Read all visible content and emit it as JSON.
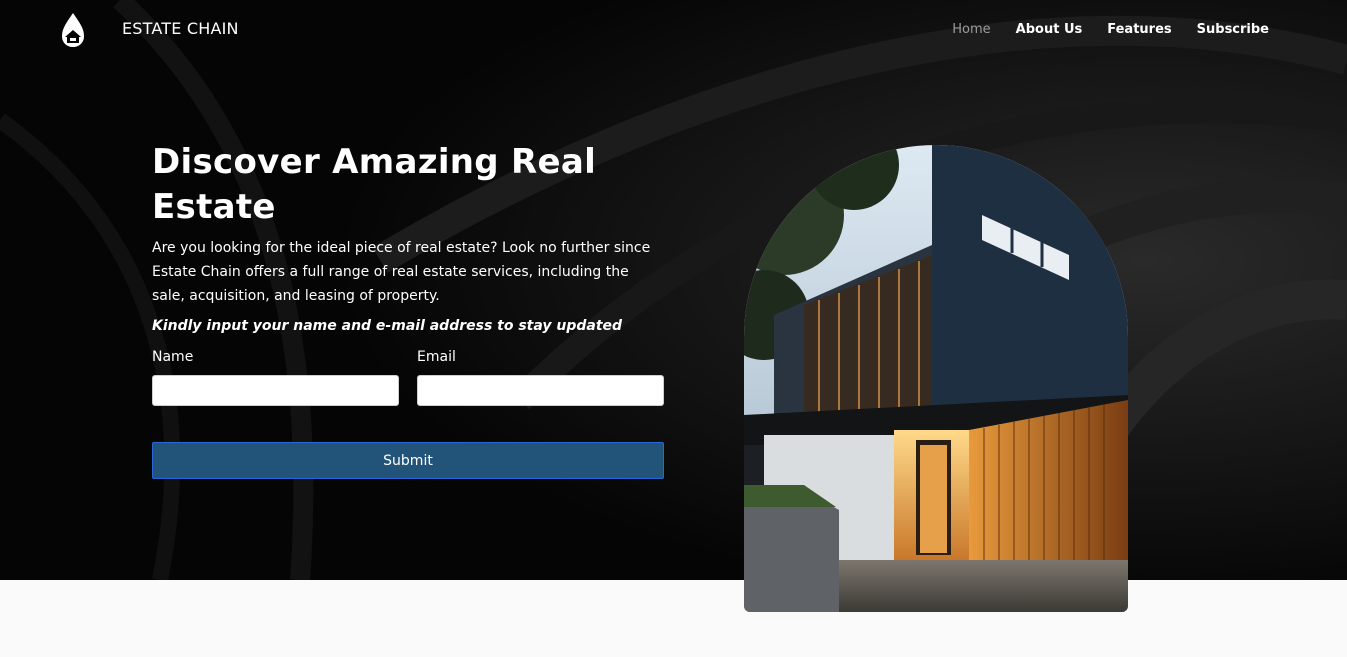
{
  "brand": {
    "name": "ESTATE CHAIN",
    "logo_icon": "house-drop-logo"
  },
  "nav": {
    "items": [
      {
        "label": "Home",
        "active": true
      },
      {
        "label": "About Us",
        "active": false
      },
      {
        "label": "Features",
        "active": false
      },
      {
        "label": "Subscribe",
        "active": false
      }
    ]
  },
  "hero": {
    "title": "Discover Amazing Real Estate",
    "description": "Are you looking for the ideal piece of real estate? Look no further since Estate Chain offers a full range of real estate services, including the sale, acquisition, and leasing of property.",
    "instruction": "Kindly input your name and e-mail address to stay updated",
    "form": {
      "name_label": "Name",
      "name_value": "",
      "email_label": "Email",
      "email_value": "",
      "submit_label": "Submit"
    }
  },
  "colors": {
    "hero_background": "#050505",
    "submit_button": "#225479",
    "page_background": "#fafafa",
    "nav_active": "#9a9a9a"
  }
}
